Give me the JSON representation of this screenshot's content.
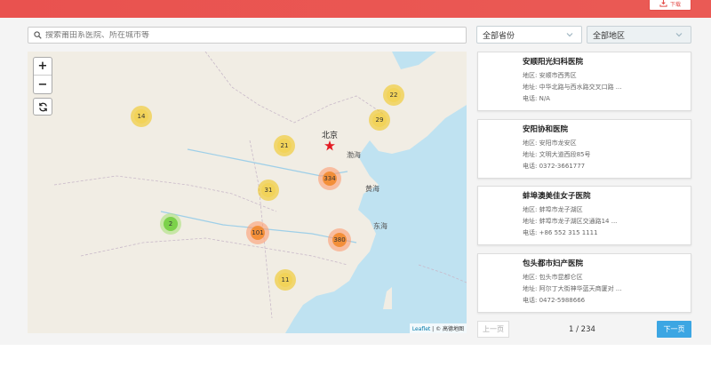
{
  "header": {
    "download_label": "下载"
  },
  "search": {
    "placeholder": "搜索莆田系医院、所在城市等",
    "value": ""
  },
  "filters": {
    "province": "全部省份",
    "region": "全部地区"
  },
  "map": {
    "city_label": "北京",
    "sea_labels": [
      "渤海",
      "黄海",
      "东海"
    ],
    "attribution_leaflet": "Leaflet",
    "attribution_rest": " | © 高德地图",
    "clusters": [
      {
        "count": "14",
        "color": "yellow"
      },
      {
        "count": "22",
        "color": "yellow"
      },
      {
        "count": "29",
        "color": "yellow"
      },
      {
        "count": "21",
        "color": "yellow"
      },
      {
        "count": "334",
        "color": "orange"
      },
      {
        "count": "31",
        "color": "yellow"
      },
      {
        "count": "2",
        "color": "green"
      },
      {
        "count": "101",
        "color": "orange"
      },
      {
        "count": "380",
        "color": "orange"
      },
      {
        "count": "11",
        "color": "yellow"
      }
    ]
  },
  "hospitals": [
    {
      "name": "安顺阳光妇科医院",
      "district": "地区: 安顺市西秀区",
      "address": "地址: 中华北路与西水路交叉口路 ...",
      "phone": "电话: N/A"
    },
    {
      "name": "安阳协和医院",
      "district": "地区: 安阳市龙安区",
      "address": "地址: 文明大道西段85号",
      "phone": "电话: 0372-3661777"
    },
    {
      "name": "蚌埠澳美佳女子医院",
      "district": "地区: 蚌埠市龙子湖区",
      "address": "地址: 蚌埠市龙子湖区交通路14 ...",
      "phone": "电话: +86 552 315 1111"
    },
    {
      "name": "包头都市妇产医院",
      "district": "地区: 包头市昆都仑区",
      "address": "地址: 阿尔丁大街神华蓝天商厦对 ...",
      "phone": "电话: 0472-5988666"
    }
  ],
  "pager": {
    "prev_label": "上一页",
    "info": "1 / 234",
    "next_label": "下一页"
  },
  "colors": {
    "header_red": "#e9524f",
    "next_blue": "#3ca6e3"
  }
}
